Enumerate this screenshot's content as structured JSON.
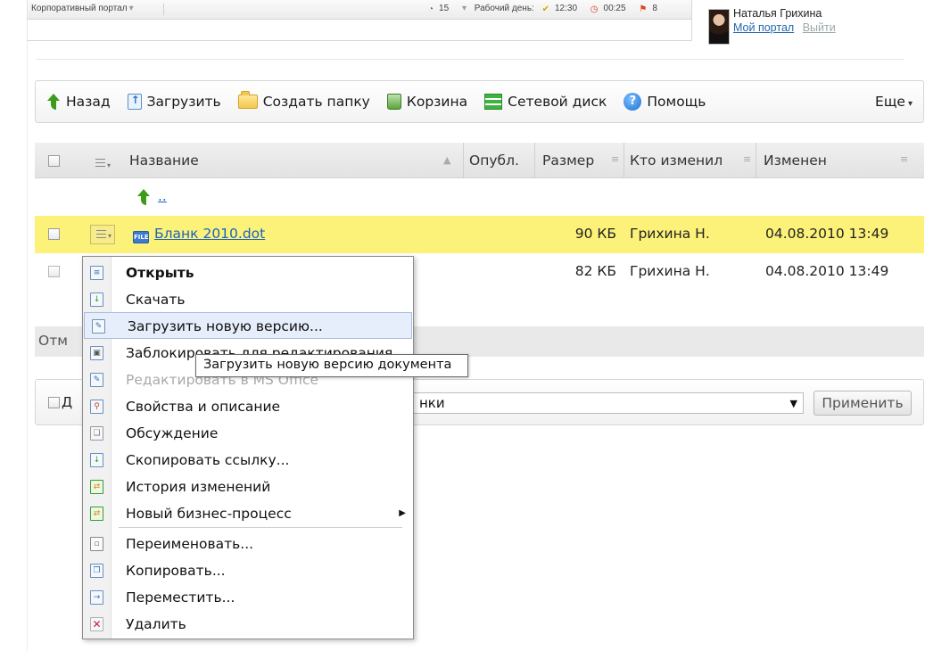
{
  "topbar": {
    "portal_menu": "Корпоративный портал",
    "tasks_count": "15",
    "workday_label": "Рабочий день:",
    "workday_time": "12:30",
    "timer": "00:25",
    "flags": "8"
  },
  "user": {
    "name": "Наталья Грихина",
    "my_portal": "Мой портал",
    "logout": "Выйти"
  },
  "toolbar": {
    "back": "Назад",
    "upload": "Загрузить",
    "create_folder": "Создать папку",
    "trash": "Корзина",
    "network_drive": "Сетевой диск",
    "help": "Помощь",
    "more": "Еще"
  },
  "table": {
    "headers": {
      "name": "Название",
      "published": "Опубл.",
      "size": "Размер",
      "modified_by": "Кто изменил",
      "modified": "Изменен"
    },
    "parent_link": "..",
    "rows": [
      {
        "name": "Бланк 2010.dot",
        "size": "90 КБ",
        "modified_by": "Грихина Н.",
        "modified": "04.08.2010 13:49"
      },
      {
        "name": "",
        "size": "82 КБ",
        "modified_by": "Грихина Н.",
        "modified": "04.08.2010 13:49"
      }
    ],
    "footer_fragment": "Отм"
  },
  "actions": {
    "apply_all_fragment": "Д",
    "select_value_fragment": "нки",
    "apply": "Применить"
  },
  "context_menu": {
    "items": [
      {
        "label": "Открыть"
      },
      {
        "label": "Скачать"
      },
      {
        "label": "Загрузить новую версию..."
      },
      {
        "label": "Заблокировать для редактирования"
      },
      {
        "label": "Редактировать в MS Office"
      },
      {
        "label": "Свойства и описание"
      },
      {
        "label": "Обсуждение"
      },
      {
        "label": "Скопировать ссылку..."
      },
      {
        "label": "История изменений"
      },
      {
        "label": "Новый бизнес-процесс"
      },
      {
        "label": "Переименовать..."
      },
      {
        "label": "Копировать..."
      },
      {
        "label": "Переместить..."
      },
      {
        "label": "Удалить"
      }
    ]
  },
  "tooltip": "Загрузить новую версию документа"
}
